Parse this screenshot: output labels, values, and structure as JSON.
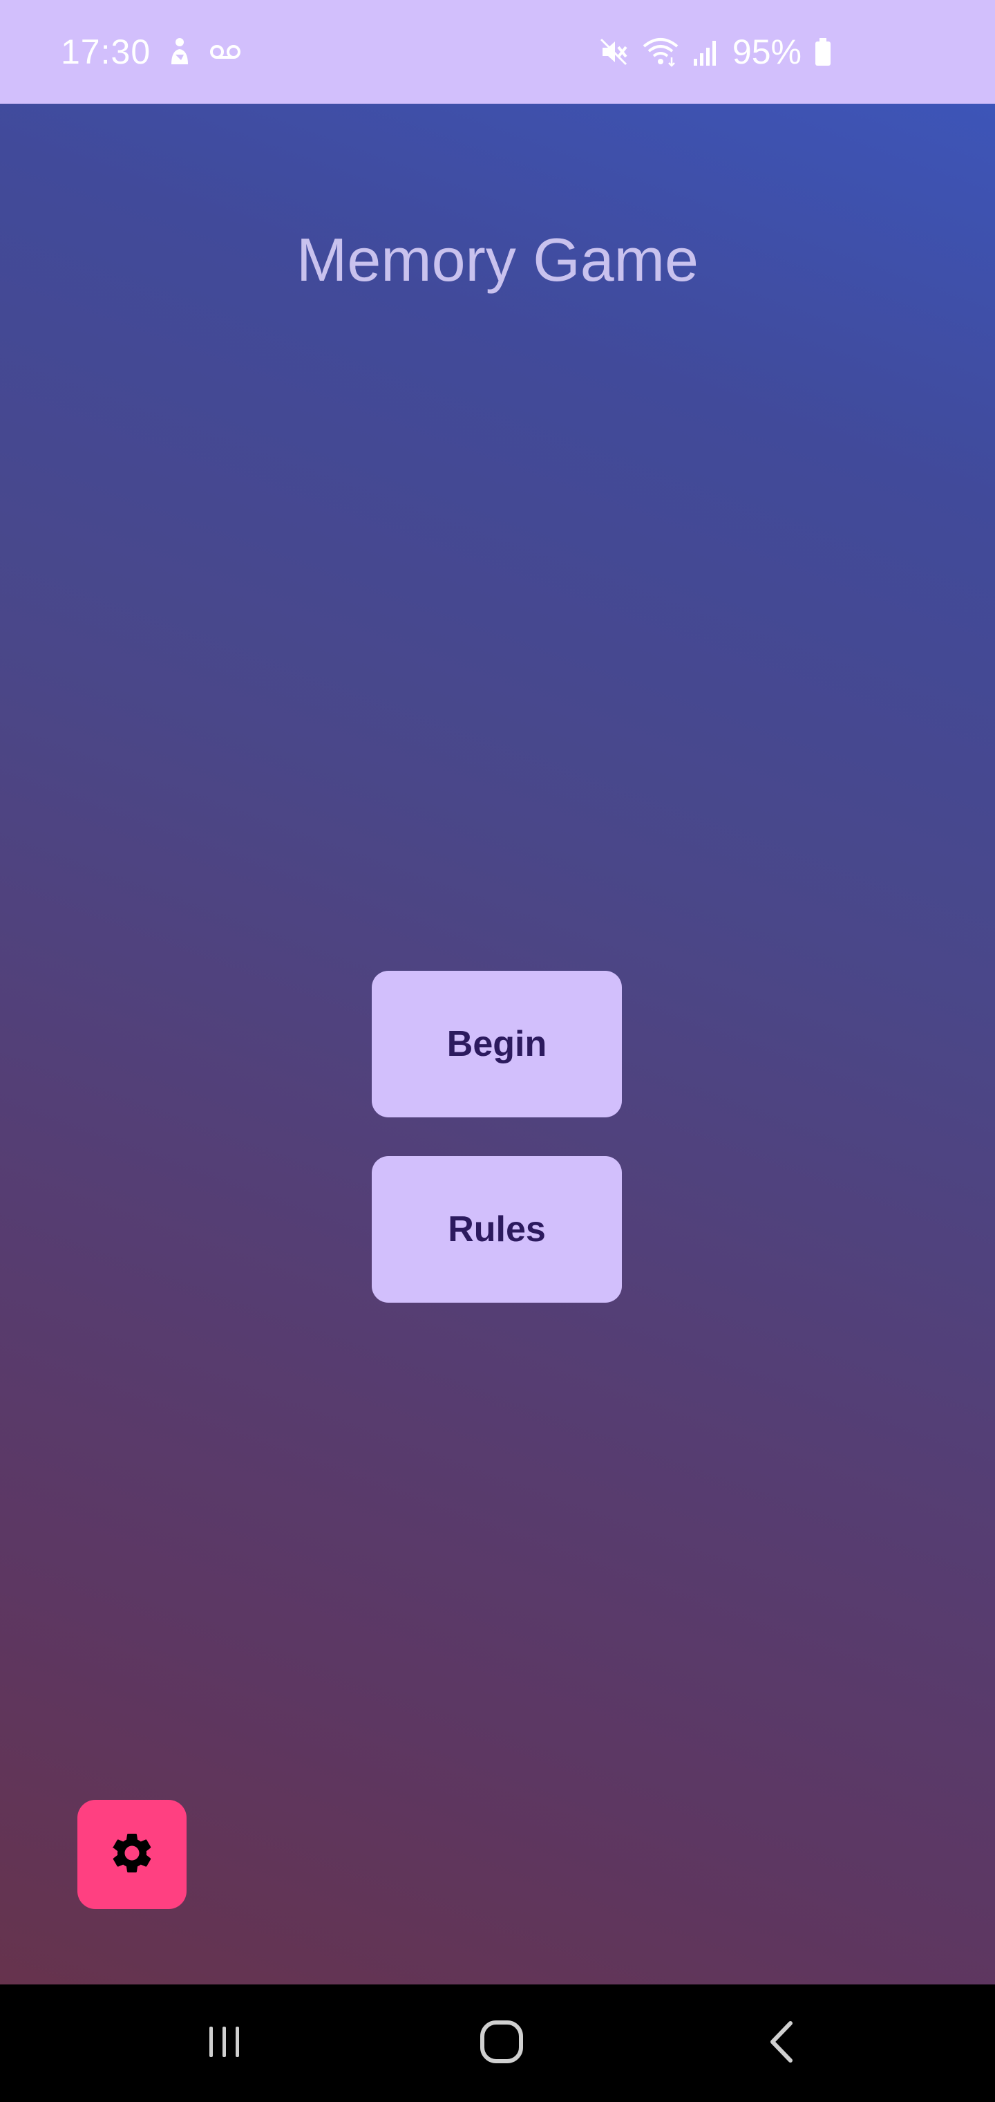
{
  "status_bar": {
    "time": "17:30",
    "battery_percent": "95%",
    "left_icons": [
      "notification-icon",
      "voicemail-icon"
    ],
    "right_icons": [
      "mute-icon",
      "wifi-icon",
      "signal-icon",
      "battery-icon"
    ],
    "background_color": "#d2bffc"
  },
  "main": {
    "title": "Memory Game",
    "buttons": {
      "begin_label": "Begin",
      "rules_label": "Rules"
    },
    "fab": {
      "icon": "gear-icon",
      "color": "#ff4081"
    }
  },
  "nav_bar": {
    "items": [
      "recents-icon",
      "home-icon",
      "back-icon"
    ]
  },
  "colors": {
    "accent": "#d2bffc",
    "button_text": "#2c1a5e",
    "fab": "#ff4081",
    "gradient_top": "#3d55b8",
    "gradient_bottom": "#66334d"
  }
}
